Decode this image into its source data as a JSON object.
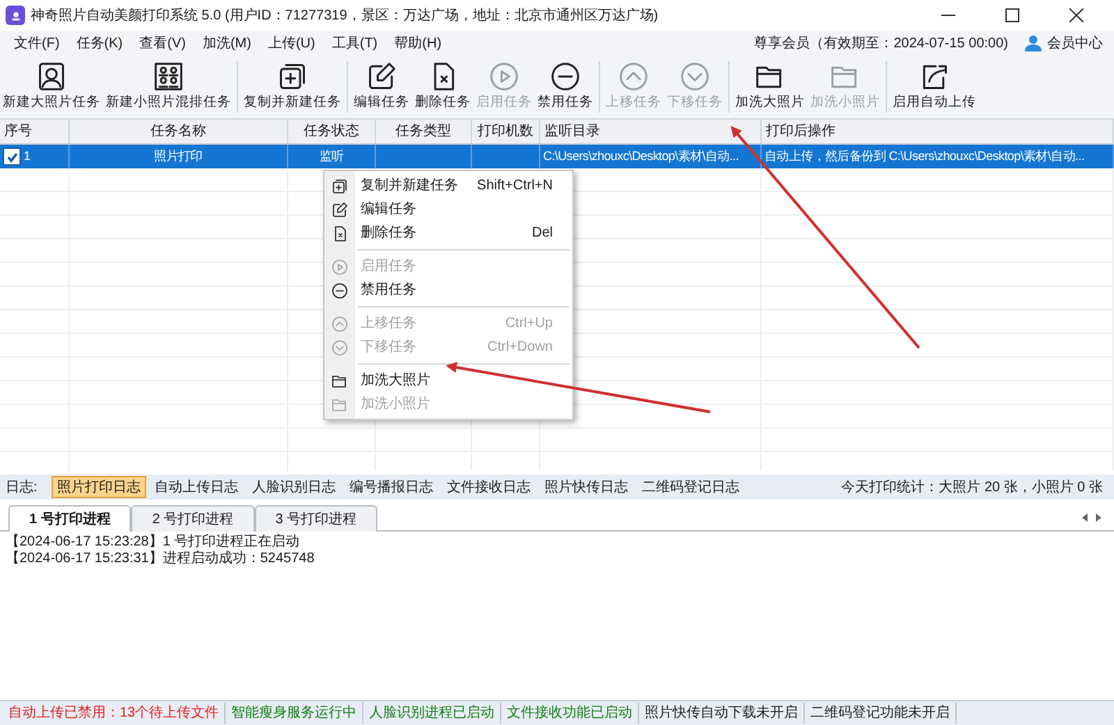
{
  "window": {
    "title": "神奇照片自动美颜打印系统 5.0 (用户ID：71277319，景区：万达广场，地址：北京市通州区万达广场)"
  },
  "menu_bar": {
    "items": [
      "文件(F)",
      "任务(K)",
      "查看(V)",
      "加洗(M)",
      "上传(U)",
      "工具(T)",
      "帮助(H)"
    ],
    "membership": "尊享会员（有效期至：2024-07-15 00:00)",
    "member_center": "会员中心"
  },
  "toolbar": {
    "groups": [
      [
        {
          "label": "新建大照片任务",
          "disabled": false
        },
        {
          "label": "新建小照片混排任务",
          "disabled": false
        }
      ],
      [
        {
          "label": "复制并新建任务",
          "disabled": false
        }
      ],
      [
        {
          "label": "编辑任务",
          "disabled": false
        },
        {
          "label": "删除任务",
          "disabled": false
        },
        {
          "label": "启用任务",
          "disabled": true
        },
        {
          "label": "禁用任务",
          "disabled": false
        }
      ],
      [
        {
          "label": "上移任务",
          "disabled": true
        },
        {
          "label": "下移任务",
          "disabled": true
        }
      ],
      [
        {
          "label": "加洗大照片",
          "disabled": false
        },
        {
          "label": "加洗小照片",
          "disabled": true
        }
      ],
      [
        {
          "label": "启用自动上传",
          "disabled": false
        }
      ]
    ]
  },
  "table": {
    "columns": [
      "序号",
      "任务名称",
      "任务状态",
      "任务类型",
      "打印机数",
      "监听目录",
      "打印后操作"
    ],
    "rows": [
      {
        "selected": true,
        "checked": true,
        "cells": [
          "1",
          "照片打印",
          "监听",
          "",
          "",
          "C:\\Users\\zhouxc\\Desktop\\素材\\自动...",
          "自动上传，然后备份到 C:\\Users\\zhouxc\\Desktop\\素材\\自动..."
        ]
      }
    ]
  },
  "context_menu": {
    "groups": [
      [
        {
          "label": "复制并新建任务",
          "shortcut": "Shift+Ctrl+N",
          "disabled": false
        },
        {
          "label": "编辑任务",
          "disabled": false
        },
        {
          "label": "删除任务",
          "shortcut": "Del",
          "disabled": false
        }
      ],
      [
        {
          "label": "启用任务",
          "disabled": true
        },
        {
          "label": "禁用任务",
          "disabled": false
        }
      ],
      [
        {
          "label": "上移任务",
          "shortcut": "Ctrl+Up",
          "disabled": true
        },
        {
          "label": "下移任务",
          "shortcut": "Ctrl+Down",
          "disabled": true
        }
      ],
      [
        {
          "label": "加洗大照片",
          "disabled": false
        },
        {
          "label": "加洗小照片",
          "disabled": true
        }
      ]
    ]
  },
  "log_bar": {
    "label": "日志:",
    "tabs": [
      {
        "label": "照片打印日志",
        "selected": true
      },
      {
        "label": "自动上传日志",
        "selected": false
      },
      {
        "label": "人脸识别日志",
        "selected": false
      },
      {
        "label": "编号播报日志",
        "selected": false
      },
      {
        "label": "文件接收日志",
        "selected": false
      },
      {
        "label": "照片快传日志",
        "selected": false
      },
      {
        "label": "二维码登记日志",
        "selected": false
      }
    ],
    "stats": "今天打印统计：大照片 20 张，小照片 0 张"
  },
  "process_tabs": [
    {
      "label": "1 号打印进程",
      "selected": true
    },
    {
      "label": "2 号打印进程",
      "selected": false
    },
    {
      "label": "3 号打印进程",
      "selected": false
    }
  ],
  "log_lines": [
    "【2024-06-17 15:23:28】1 号打印进程正在启动",
    "【2024-06-17 15:23:31】进程启动成功：5245748"
  ],
  "status_bar": [
    {
      "text": "自动上传已禁用：13个待上传文件",
      "color": "#e02020"
    },
    {
      "text": "智能瘦身服务运行中",
      "color": "#108010"
    },
    {
      "text": "人脸识别进程已启动",
      "color": "#108010"
    },
    {
      "text": "文件接收功能已启动",
      "color": "#108010"
    },
    {
      "text": "照片快传自动下载未开启",
      "color": "#202020"
    },
    {
      "text": "二维码登记功能未开启",
      "color": "#202020"
    }
  ]
}
